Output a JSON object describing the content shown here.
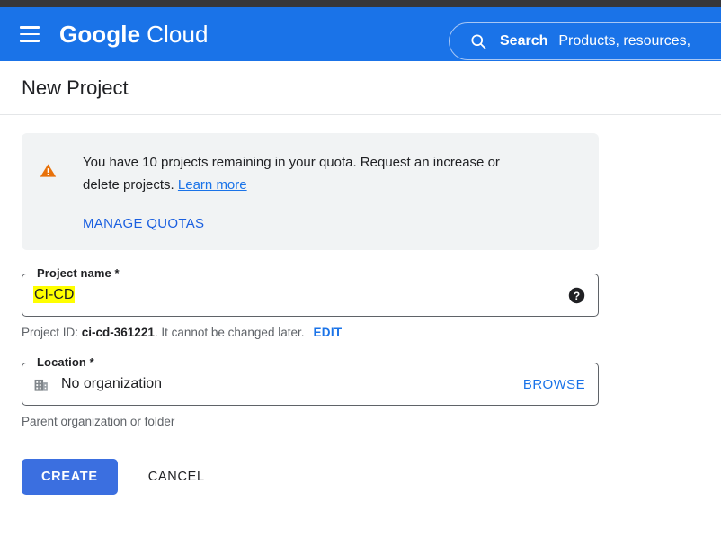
{
  "appbar": {
    "menu_icon": "hamburger-menu-icon",
    "brand_bold": "Google",
    "brand_light": "Cloud",
    "search": {
      "icon": "search-icon",
      "label": "Search",
      "placeholder": "Products, resources,"
    },
    "background_color": "#1a73e8"
  },
  "page": {
    "title": "New Project"
  },
  "notice": {
    "icon": "warning-triangle-icon",
    "icon_color": "#e8710a",
    "background_color": "#f1f3f4",
    "text_before_link": "You have 10 projects remaining in your quota. Request an increase or delete projects. ",
    "learn_more_label": "Learn more",
    "manage_quotas_label": "MANAGE QUOTAS",
    "link_color": "#1a73e8"
  },
  "project_name_field": {
    "label": "Project name *",
    "value": "CI-CD",
    "value_highlight_color": "#ffff00",
    "help_icon": "help-circle-icon",
    "hint_prefix": "Project ID: ",
    "hint_id": "ci-cd-361221",
    "hint_suffix": ". It cannot be changed later.",
    "edit_label": "EDIT"
  },
  "location_field": {
    "label": "Location *",
    "icon": "organization-building-icon",
    "value": "No organization",
    "browse_label": "BROWSE",
    "hint": "Parent organization or folder"
  },
  "actions": {
    "create_label": "CREATE",
    "cancel_label": "CANCEL",
    "create_color": "#3b6fe0"
  }
}
